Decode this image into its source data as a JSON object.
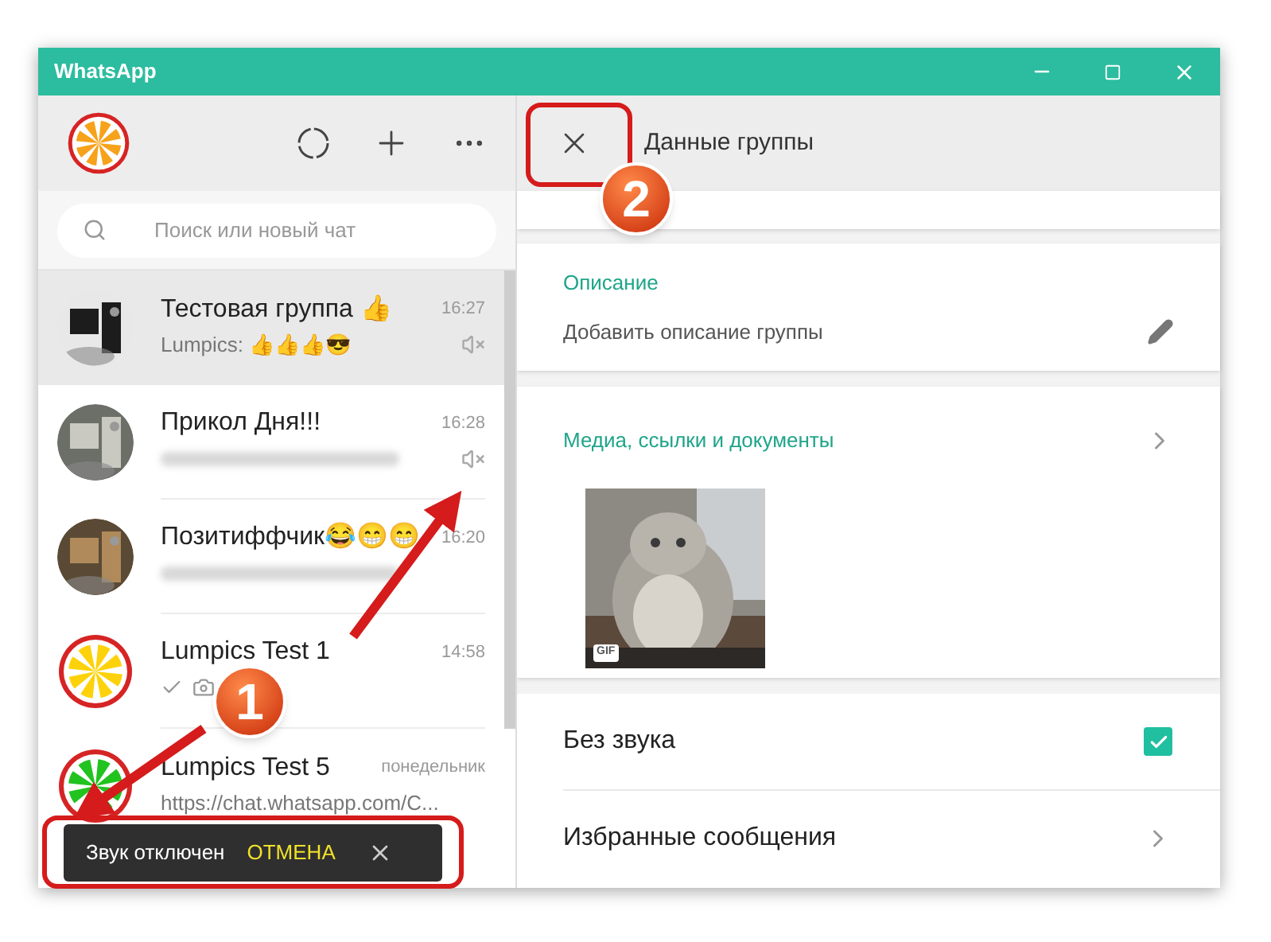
{
  "window": {
    "title": "WhatsApp"
  },
  "search": {
    "placeholder": "Поиск или новый чат"
  },
  "chats": [
    {
      "name": "Тестовая группа 👍",
      "time": "16:27",
      "preview": "Lumpics: 👍👍👍😎",
      "preview_blurred": false,
      "sent": false,
      "photo": false,
      "muted": true,
      "selected": true
    },
    {
      "name": "Прикол Дня!!!",
      "time": "16:28",
      "preview_blurred": true,
      "sent": false,
      "photo": false,
      "muted": true,
      "selected": false
    },
    {
      "name": "Позитиффчик😂😁😁",
      "time": "16:20",
      "preview_blurred": true,
      "sent": false,
      "photo": false,
      "muted": false,
      "selected": false
    },
    {
      "name": "Lumpics Test 1",
      "time": "14:58",
      "preview_blurred": false,
      "sent": true,
      "photo": true,
      "muted": false,
      "selected": false,
      "avatar": {
        "kind": "citrus",
        "color": "#fdd20a"
      }
    },
    {
      "name": "Lumpics Test 5",
      "time": "понедельник",
      "preview": "https://chat.whatsapp.com/C...",
      "preview_blurred": false,
      "sent": false,
      "photo": false,
      "muted": false,
      "selected": false,
      "avatar": {
        "kind": "citrus",
        "color": "#22c21f"
      }
    }
  ],
  "toast": {
    "message": "Звук отключен",
    "action": "ОТМЕНА"
  },
  "details": {
    "title": "Данные группы",
    "description": {
      "label": "Описание",
      "hint": "Добавить описание группы"
    },
    "media": {
      "title": "Медиа, ссылки и документы",
      "items": [
        {
          "kind": "picture",
          "badge": "GIF"
        }
      ]
    },
    "settings": [
      {
        "kind": "checkbox",
        "label": "Без звука",
        "checked": true
      },
      {
        "kind": "link",
        "label": "Избранные сообщения"
      }
    ]
  },
  "annotations": [
    {
      "label": "1"
    },
    {
      "label": "2"
    }
  ]
}
